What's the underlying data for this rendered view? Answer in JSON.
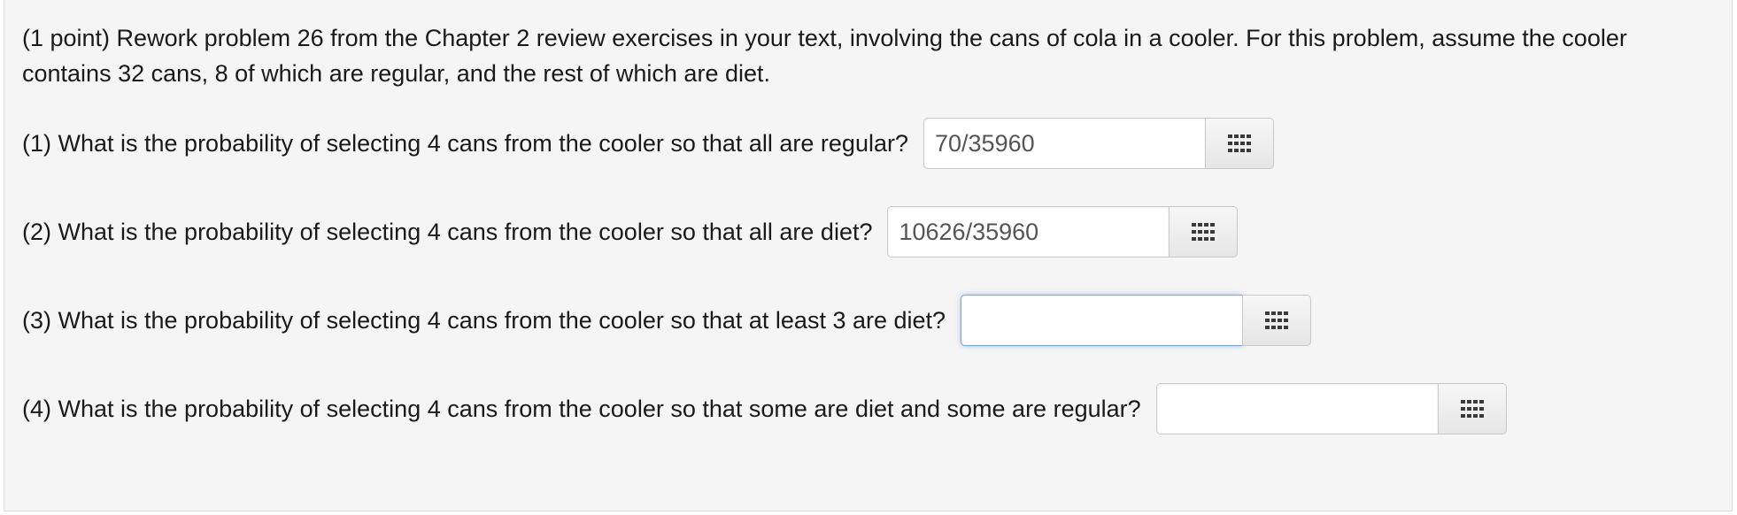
{
  "problem": {
    "intro": "(1 point) Rework problem 26 from the Chapter 2 review exercises in your text, involving the cans of cola in a cooler. For this problem, assume the cooler contains 32 cans, 8 of which are regular, and the rest of which are diet."
  },
  "questions": [
    {
      "label": "(1) What is the probability of selecting 4 cans from the cooler so that all are regular?",
      "answer": "70/35960"
    },
    {
      "label": "(2) What is the probability of selecting 4 cans from the cooler so that all are diet?",
      "answer": "10626/35960"
    },
    {
      "label": "(3) What is the probability of selecting 4 cans from the cooler so that at least 3 are diet?",
      "answer": ""
    },
    {
      "label": "(4) What is the probability of selecting 4 cans from the cooler so that some are diet and some are regular?",
      "answer": ""
    }
  ],
  "icons": {
    "equation_editor": "grid-icon"
  },
  "colors": {
    "panel_background": "#f5f5f5",
    "focus_border": "#7aa6da"
  }
}
